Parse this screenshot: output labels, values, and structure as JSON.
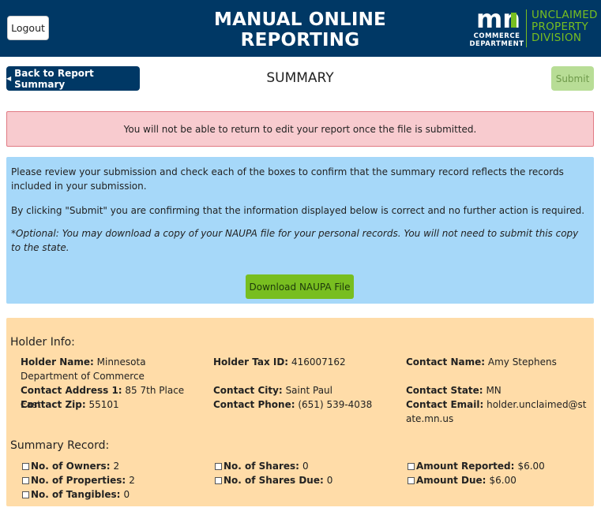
{
  "header": {
    "logout_label": "Logout",
    "title": "MANUAL ONLINE REPORTING",
    "logo": {
      "mark": "mn",
      "department_line1": "COMMERCE",
      "department_line2": "DEPARTMENT",
      "division_line1": "UNCLAIMED",
      "division_line2": "PROPERTY",
      "division_line3": "DIVISION",
      "mark_color": "#78be20"
    },
    "background_color": "#003865"
  },
  "toolbar": {
    "back_label": "Back to Report Summary",
    "page_title": "SUMMARY",
    "submit_label": "Submit"
  },
  "warning_text": "You will not be able to return to edit your report once the file is submitted.",
  "info": {
    "paragraph1": "Please review your submission and check each of the boxes to confirm that the summary record reflects the records included in your submission.",
    "paragraph2": "By clicking \"Submit\" you are confirming that the information displayed below is correct and no further action is required.",
    "paragraph3": "*Optional: You may download a copy of your NAUPA file for your personal records. You will not need to submit this copy to the state.",
    "download_label": "Download NAUPA File"
  },
  "holder_info": {
    "section_title": "Holder Info:",
    "fields": {
      "holder_name": {
        "label": "Holder Name:",
        "value": "Minnesota Department of Commerce"
      },
      "holder_tax_id": {
        "label": "Holder Tax ID:",
        "value": "416007162"
      },
      "contact_name": {
        "label": "Contact Name:",
        "value": "Amy Stephens"
      },
      "contact_address": {
        "label": "Contact Address 1:",
        "value": "85 7th Place East"
      },
      "contact_city": {
        "label": "Contact City:",
        "value": "Saint Paul"
      },
      "contact_state": {
        "label": "Contact State:",
        "value": "MN"
      },
      "contact_zip": {
        "label": "Contact Zip:",
        "value": "55101"
      },
      "contact_phone": {
        "label": "Contact Phone:",
        "value": "(651) 539-4038"
      },
      "contact_email": {
        "label": "Contact Email:",
        "value": "holder.unclaimed@state.mn.us"
      }
    }
  },
  "summary_record": {
    "section_title": "Summary Record:",
    "items": {
      "owners": {
        "label": "No. of Owners:",
        "value": "2"
      },
      "properties": {
        "label": "No. of Properties:",
        "value": "2"
      },
      "tangibles": {
        "label": "No. of Tangibles:",
        "value": "0"
      },
      "shares": {
        "label": "No. of Shares:",
        "value": "0"
      },
      "shares_due": {
        "label": "No. of Shares Due:",
        "value": "0"
      },
      "amount_reported": {
        "label": "Amount Reported:",
        "value": "$6.00"
      },
      "amount_due": {
        "label": "Amount Due:",
        "value": "$6.00"
      }
    }
  }
}
